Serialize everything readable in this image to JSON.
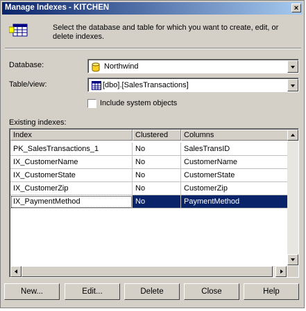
{
  "window": {
    "title": "Manage Indexes - KITCHEN",
    "close_glyph": "×"
  },
  "intro": {
    "text": "Select the database and table for which you want to create, edit, or delete indexes."
  },
  "database": {
    "label": "Database:",
    "value": "Northwind"
  },
  "table": {
    "label": "Table/view:",
    "value": "[dbo].[SalesTransactions]"
  },
  "system_objects": {
    "label": "Include system objects",
    "checked": false
  },
  "existing": {
    "label": "Existing indexes:",
    "columns": [
      "Index",
      "Clustered",
      "Columns"
    ],
    "rows": [
      {
        "index": "PK_SalesTransactions_1",
        "clustered": "No",
        "columns": "SalesTransID"
      },
      {
        "index": "IX_CustomerName",
        "clustered": "No",
        "columns": "CustomerName"
      },
      {
        "index": "IX_CustomerState",
        "clustered": "No",
        "columns": "CustomerState"
      },
      {
        "index": "IX_CustomerZip",
        "clustered": "No",
        "columns": "CustomerZip"
      },
      {
        "index": "IX_PaymentMethod",
        "clustered": "No",
        "columns": "PaymentMethod"
      }
    ],
    "selected_row": 4
  },
  "buttons": {
    "new": "New...",
    "edit": "Edit...",
    "delete": "Delete",
    "close": "Close",
    "help": "Help"
  },
  "colors": {
    "title_bar": "#0a246a",
    "selection": "#0a246a",
    "face": "#d4d0c8"
  },
  "icons": [
    "table-grid-icon",
    "database-cylinder-icon",
    "table-icon",
    "close-icon",
    "chevron-down-icon"
  ]
}
